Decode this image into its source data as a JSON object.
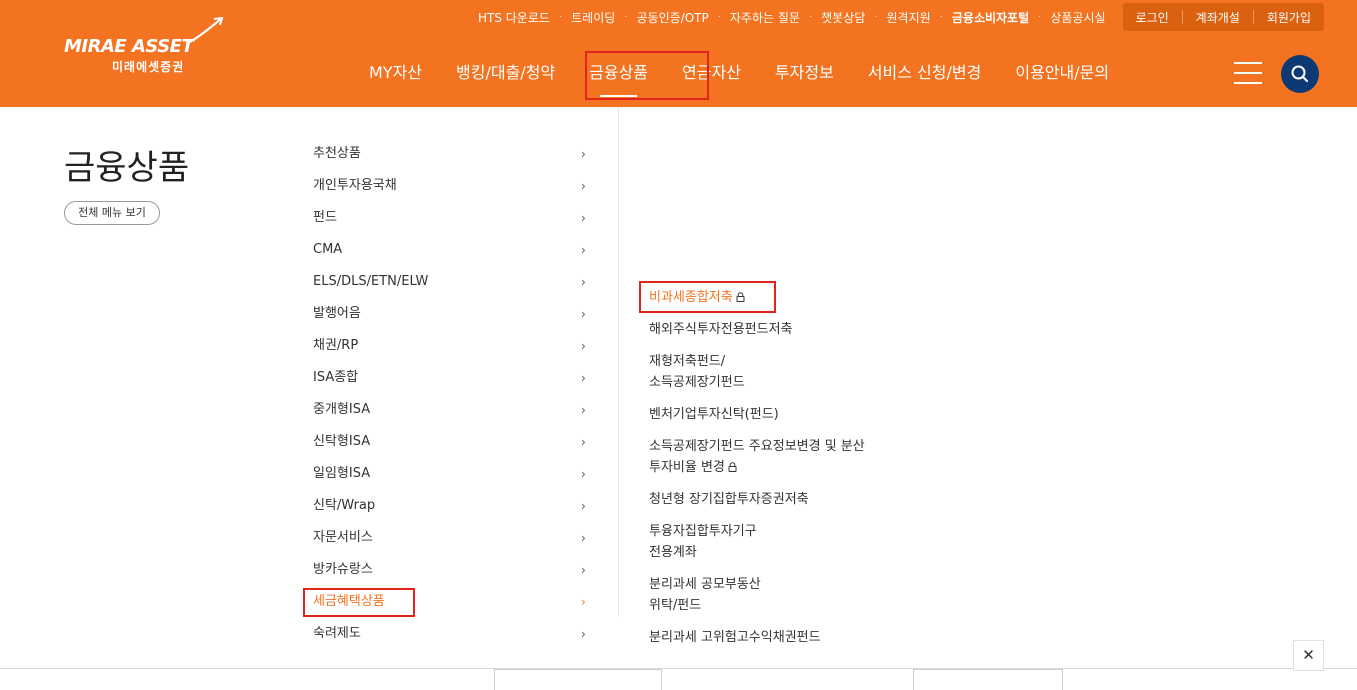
{
  "brand": {
    "name_en": "MIRAE ASSET",
    "name_ko": "미래에셋증권",
    "color": "#f37321",
    "accent_dark": "#0d3a74"
  },
  "util_nav": {
    "links": [
      "HTS 다운로드",
      "트레이딩",
      "공동인증/OTP",
      "자주하는 질문",
      "챗봇상담",
      "원격지원",
      "금융소비자포털",
      "상품공시실"
    ],
    "account": [
      "로그인",
      "계좌개설",
      "회원가입"
    ]
  },
  "gnb": [
    "MY자산",
    "뱅킹/대출/청약",
    "금융상품",
    "연금자산",
    "투자정보",
    "서비스 신청/변경",
    "이용안내/문의"
  ],
  "icons": {
    "menu": "hamburger-icon",
    "search": "search-icon",
    "close": "close-icon",
    "chevron": "chevron-right-icon",
    "lock": "lock-icon"
  },
  "page": {
    "title": "금융상품",
    "all_menu_label": "전체 메뉴 보기"
  },
  "lnb": [
    "추천상품",
    "개인투자용국채",
    "펀드",
    "CMA",
    "ELS/DLS/ETN/ELW",
    "발행어음",
    "채권/RP",
    "ISA종합",
    "중개형ISA",
    "신탁형ISA",
    "일임형ISA",
    "신탁/Wrap",
    "자문서비스",
    "방카슈랑스",
    "세금혜택상품",
    "숙려제도"
  ],
  "lnb_active_index": 14,
  "submenu": [
    {
      "lines": [
        "비과세종합저축"
      ],
      "locked": true,
      "active": true
    },
    {
      "lines": [
        "해외주식투자전용펀드저축"
      ],
      "locked": false,
      "active": false
    },
    {
      "lines": [
        "재형저축펀드/",
        "소득공제장기펀드"
      ],
      "locked": false,
      "active": false
    },
    {
      "lines": [
        "벤처기업투자신탁(펀드)"
      ],
      "locked": false,
      "active": false
    },
    {
      "lines": [
        "소득공제장기펀드 주요정보변경 및 분산",
        "투자비율 변경"
      ],
      "locked": true,
      "active": false
    },
    {
      "lines": [
        "청년형 장기집합투자증권저축"
      ],
      "locked": false,
      "active": false
    },
    {
      "lines": [
        "투융자집합투자기구",
        "전용계좌"
      ],
      "locked": false,
      "active": false
    },
    {
      "lines": [
        "분리과세 공모부동산",
        "위탁/펀드"
      ],
      "locked": false,
      "active": false
    },
    {
      "lines": [
        "분리과세 고위험고수익채권펀드"
      ],
      "locked": false,
      "active": false
    }
  ]
}
